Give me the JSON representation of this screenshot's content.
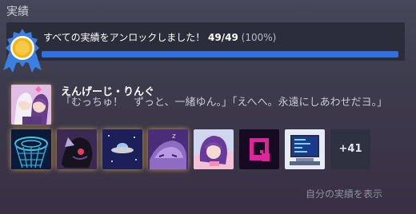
{
  "section": {
    "title": "実績"
  },
  "progress": {
    "text": "すべての実績をアンロックしました！",
    "count": "49/49",
    "percent_label": "(100%)",
    "fraction": 1.0
  },
  "rarest": {
    "name": "えんげーじ・りんぐ",
    "description": "「むっちゅ！　ずっと、一緒ゆん。」「えへへ。永遠にしあわせだヨ。」"
  },
  "more_count": "+41",
  "show_own_link": "自分の実績を表示",
  "colors": {
    "progress_fill": "#2f6fe0",
    "progress_track": "#1e2e4a",
    "medal_gold": "#f2b516",
    "medal_ribbon": "#3b7fe0"
  },
  "icons": [
    "warp-tunnel-icon",
    "dark-creature-icon",
    "ufo-icon",
    "sleeping-character-icon",
    "girl-on-pillow-icon",
    "letter-q-icon",
    "retro-computer-icon"
  ]
}
